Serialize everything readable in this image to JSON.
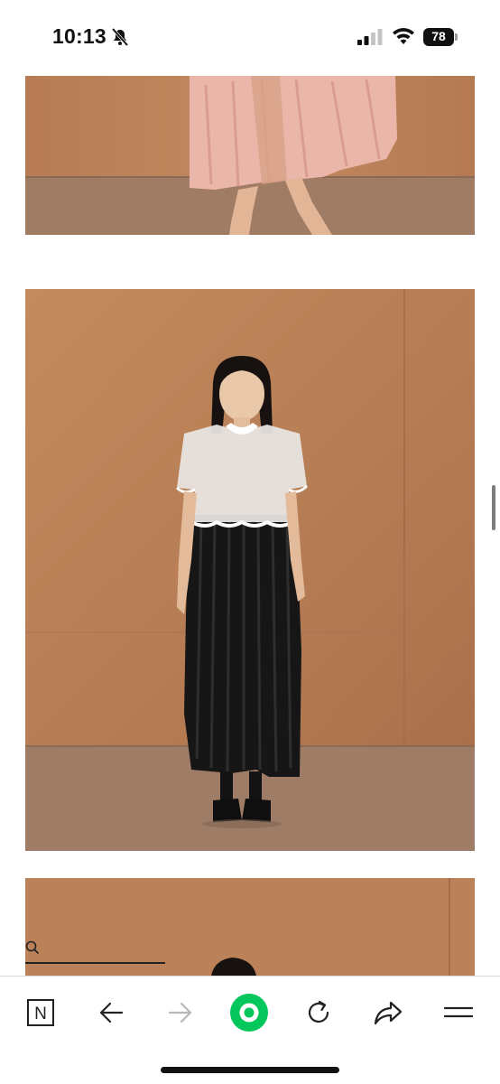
{
  "status_bar": {
    "time": "10:13",
    "bell_icon": "bell-slash-icon",
    "signal_icon": "cellular-signal-icon",
    "wifi_icon": "wifi-icon",
    "battery_level": "78"
  },
  "content": {
    "photos": [
      {
        "name": "photo-1",
        "subject": "pink-pleated-dress-lower"
      },
      {
        "name": "photo-2",
        "subject": "black-dress-with-white-top"
      },
      {
        "name": "photo-3",
        "subject": "next-look-partial"
      }
    ],
    "search_icon": "search-icon"
  },
  "toolbar": {
    "items": [
      {
        "icon": "naver-n-icon"
      },
      {
        "icon": "back-arrow-icon"
      },
      {
        "icon": "forward-arrow-icon"
      },
      {
        "icon": "green-circle-home-icon"
      },
      {
        "icon": "reload-icon"
      },
      {
        "icon": "share-icon"
      },
      {
        "icon": "menu-icon"
      }
    ],
    "naver_letter": "N"
  },
  "colors": {
    "wall": "#b97f57",
    "floor": "#9e7a63",
    "accent_green": "#03c75a",
    "toolbar_icon": "#222222",
    "disabled_icon": "#b8b8b8"
  }
}
